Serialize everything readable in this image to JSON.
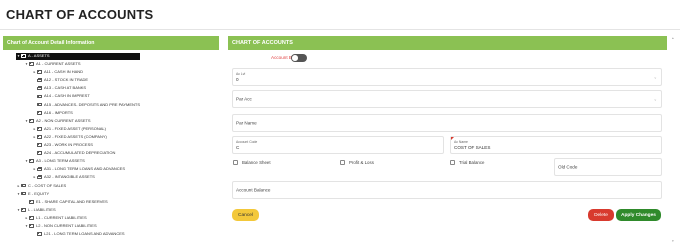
{
  "page": {
    "title": "CHART OF ACCOUNTS"
  },
  "left_panel": {
    "header": "Chart of Account Detail Information",
    "tree": [
      {
        "label": "A - ASSETS",
        "level": 0,
        "caret": "▾",
        "selected": true
      },
      {
        "label": "A1 - CURRENT ASSETS",
        "level": 1,
        "caret": "▾"
      },
      {
        "label": "A11 - CASH IN HAND",
        "level": 2,
        "caret": "▸"
      },
      {
        "label": "A12 - STOCK IN TRADE",
        "level": 2,
        "caret": ""
      },
      {
        "label": "A13 - CASH AT BANKS",
        "level": 2,
        "caret": ""
      },
      {
        "label": "A14 - CASH IN IMPREST",
        "level": 2,
        "caret": ""
      },
      {
        "label": "A15 - ADVANCES- DEPOSITS AND PRE PAYMENTS",
        "level": 2,
        "caret": ""
      },
      {
        "label": "A16 - IMPORTS",
        "level": 2,
        "caret": ""
      },
      {
        "label": "A2 - NON CURRENT ASSETS",
        "level": 1,
        "caret": "▾"
      },
      {
        "label": "A21 - FIXED ASSET (PERSONAL)",
        "level": 2,
        "caret": "▸"
      },
      {
        "label": "A22 - FIXED ASSETS (COMPANY)",
        "level": 2,
        "caret": "▸"
      },
      {
        "label": "A23 - WORK IN PROCESS",
        "level": 2,
        "caret": ""
      },
      {
        "label": "A24 - ACCUMULATED DEPRECIATION",
        "level": 2,
        "caret": ""
      },
      {
        "label": "A3 - LONG TERM ASSETS",
        "level": 1,
        "caret": "▾"
      },
      {
        "label": "A31 - LONG TERM LOANS AND ADVANCES",
        "level": 2,
        "caret": "▸"
      },
      {
        "label": "A32 - INTANGIBLE ASSETS",
        "level": 2,
        "caret": "▸"
      },
      {
        "label": "C - COST OF SALES",
        "level": 0,
        "caret": "▸"
      },
      {
        "label": "E - EQUITY",
        "level": 0,
        "caret": "▾"
      },
      {
        "label": "E1 - SHARE CAPITAL AND RESERVES",
        "level": 1,
        "caret": ""
      },
      {
        "label": "L - LIABILITIES",
        "level": 0,
        "caret": "▾"
      },
      {
        "label": "L1 - CURRENT LIABILITIES",
        "level": 1,
        "caret": "▸"
      },
      {
        "label": "L2 - NON CURRENT LIABILITIES",
        "level": 1,
        "caret": "▾"
      },
      {
        "label": "L21 - LONG TERM LOANS AND ADVANCES",
        "level": 2,
        "caret": ""
      }
    ]
  },
  "right_panel": {
    "header": "CHART OF ACCOUNTS",
    "account_block_label": "Account Block",
    "ac_lvl": {
      "label": "Ac Lvl",
      "value": "0"
    },
    "par_acc": {
      "placeholder": "Par Acc"
    },
    "par_name": {
      "placeholder": "Par Name"
    },
    "account_code": {
      "label": "Account Code",
      "value": "C"
    },
    "ac_name": {
      "label": "Ac Name",
      "value": "COST OF SALES"
    },
    "checkboxes": {
      "balance_sheet": "Balance Sheet",
      "profit_loss": "Profit & Loss",
      "trial_balance": "Trial Balance"
    },
    "old_code": {
      "placeholder": "Old Code"
    },
    "account_balance": {
      "placeholder": "Account Balance"
    },
    "buttons": {
      "cancel": "Cancel",
      "delete": "Delete",
      "apply": "Apply Changes"
    }
  },
  "colors": {
    "header_green": "#8bc153",
    "apply_green": "#2f8a2b",
    "delete_red": "#d83a2e",
    "cancel_yellow": "#f3c83a"
  }
}
